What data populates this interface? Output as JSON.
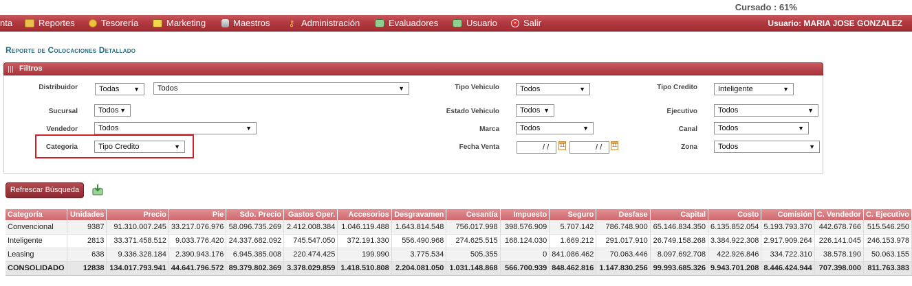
{
  "header": {
    "cursado": "Cursado : 61%",
    "usuario": "Usuario:  MARIA JOSE GONZALEZ"
  },
  "menu": [
    {
      "label": "nta",
      "icon": ""
    },
    {
      "label": "Reportes",
      "icon": "folder-icon"
    },
    {
      "label": "Tesorería",
      "icon": "coin-icon"
    },
    {
      "label": "Marketing",
      "icon": "monitor-icon"
    },
    {
      "label": "Maestros",
      "icon": "database-icon"
    },
    {
      "label": "Administración",
      "icon": "key-icon"
    },
    {
      "label": "Evaluadores",
      "icon": "evaluator-icon"
    },
    {
      "label": "Usuario",
      "icon": "user-icon"
    },
    {
      "label": "Salir",
      "icon": "exit-icon"
    }
  ],
  "page": {
    "title": "Reporte de Colocaciones Detallado"
  },
  "filters": {
    "title": "Filtros",
    "distribuidor": {
      "label": "Distribuidor",
      "value1": "Todas",
      "value2": "Todos"
    },
    "sucursal": {
      "label": "Sucursal",
      "value": "Todos"
    },
    "vendedor": {
      "label": "Vendedor",
      "value": "Todos"
    },
    "categoria": {
      "label": "Categoria",
      "value": "Tipo Credito"
    },
    "tipo_vehiculo": {
      "label": "Tipo Vehiculo",
      "value": "Todos"
    },
    "estado_vehiculo": {
      "label": "Estado Vehiculo",
      "value": "Todos"
    },
    "marca": {
      "label": "Marca",
      "value": "Todos"
    },
    "fecha_venta": {
      "label": "Fecha Venta",
      "from": "/ /",
      "to": "/ /"
    },
    "tipo_credito": {
      "label": "Tipo Credito",
      "value": "Inteligente"
    },
    "ejecutivo": {
      "label": "Ejecutivo",
      "value": "Todos"
    },
    "canal": {
      "label": "Canal",
      "value": "Todos"
    },
    "zona": {
      "label": "Zona",
      "value": "Todos"
    }
  },
  "actions": {
    "refresh": "Refrescar Búsqueda"
  },
  "table": {
    "headers": [
      "Categoría",
      "Unidades",
      "Precio",
      "Pie",
      "Sdo. Precio",
      "Gastos Oper.",
      "Accesorios",
      "Desgravamen",
      "Cesantía",
      "Impuesto",
      "Seguro",
      "Desfase",
      "Capital",
      "Costo",
      "Comisión",
      "C. Vendedor",
      "C. Ejecutivo"
    ],
    "rows": [
      [
        "Convencional",
        "9387",
        "91.310.007.245",
        "33.217.076.976",
        "58.096.735.269",
        "2.412.008.384",
        "1.046.119.488",
        "1.643.814.548",
        "756.017.998",
        "398.576.909",
        "5.707.142",
        "786.748.900",
        "65.146.834.350",
        "6.135.852.054",
        "5.193.793.370",
        "442.678.766",
        "515.546.250"
      ],
      [
        "Inteligente",
        "2813",
        "33.371.458.512",
        "9.033.776.420",
        "24.337.682.092",
        "745.547.050",
        "372.191.330",
        "556.490.968",
        "274.625.515",
        "168.124.030",
        "1.669.212",
        "291.017.910",
        "26.749.158.268",
        "3.384.922.308",
        "2.917.909.264",
        "226.141.045",
        "246.153.978"
      ],
      [
        "Leasing",
        "638",
        "9.336.328.184",
        "2.390.943.176",
        "6.945.385.008",
        "220.474.425",
        "199.990",
        "3.775.534",
        "505.355",
        "0",
        "841.086.462",
        "70.063.446",
        "8.097.692.708",
        "422.926.846",
        "334.722.310",
        "38.578.190",
        "50.063.155"
      ]
    ],
    "total": [
      "CONSOLIDADO",
      "12838",
      "134.017.793.941",
      "44.641.796.572",
      "89.379.802.369",
      "3.378.029.859",
      "1.418.510.808",
      "2.204.081.050",
      "1.031.148.868",
      "566.700.939",
      "848.462.816",
      "1.147.830.256",
      "99.993.685.326",
      "9.943.701.208",
      "8.446.424.944",
      "707.398.000",
      "811.763.383"
    ]
  }
}
